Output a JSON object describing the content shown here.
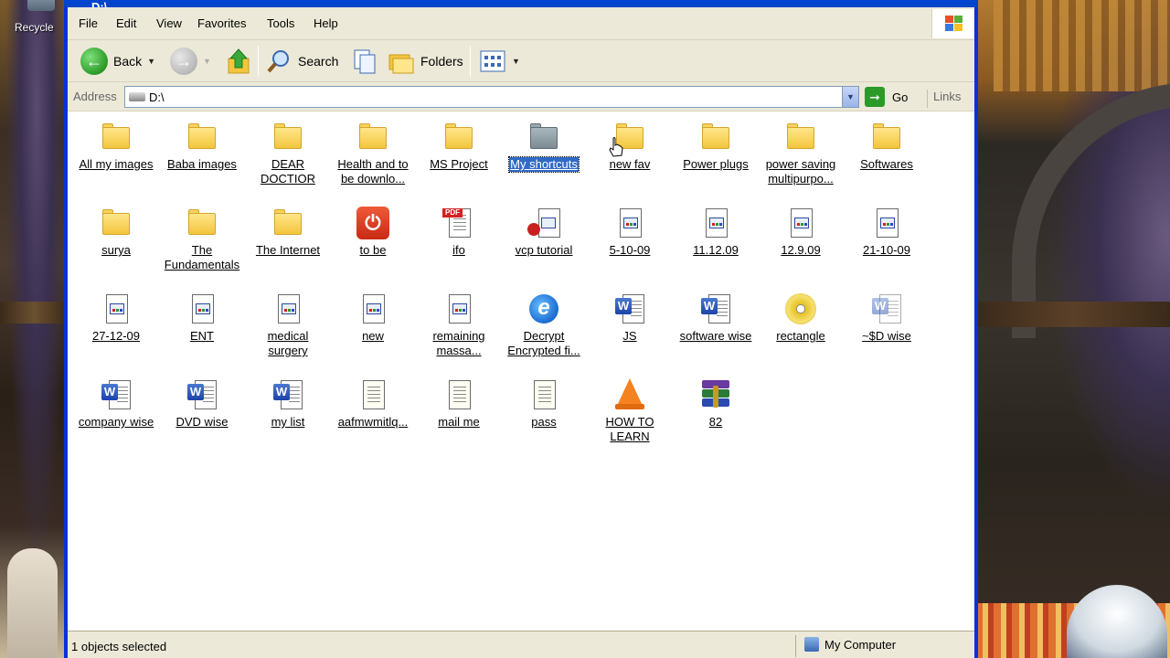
{
  "desktop": {
    "recycle_label": "Recycle"
  },
  "window": {
    "title": "D:\\"
  },
  "menu": [
    "File",
    "Edit",
    "View",
    "Favorites",
    "Tools",
    "Help"
  ],
  "toolbar": {
    "back": "Back",
    "search": "Search",
    "folders": "Folders"
  },
  "address": {
    "label": "Address",
    "value": "D:\\",
    "go": "Go",
    "links": "Links"
  },
  "items": [
    {
      "name": "All my images",
      "type": "folder"
    },
    {
      "name": "Baba images",
      "type": "folder"
    },
    {
      "name": "DEAR DOCTIOR",
      "type": "folder"
    },
    {
      "name": "Health and to be downlo...",
      "type": "folder"
    },
    {
      "name": "MS Project",
      "type": "folder"
    },
    {
      "name": "My shortcuts",
      "type": "folder-shortcut",
      "selected": true
    },
    {
      "name": "new fav",
      "type": "folder"
    },
    {
      "name": "Power plugs",
      "type": "folder"
    },
    {
      "name": "power saving multipurpo...",
      "type": "folder"
    },
    {
      "name": "Softwares",
      "type": "folder"
    },
    {
      "name": "surya",
      "type": "folder"
    },
    {
      "name": "The Fundamentals",
      "type": "folder"
    },
    {
      "name": "The Internet",
      "type": "folder"
    },
    {
      "name": "to be",
      "type": "power-app"
    },
    {
      "name": "ifo",
      "type": "pdf"
    },
    {
      "name": "vcp tutorial",
      "type": "vcp"
    },
    {
      "name": "5-10-09",
      "type": "doc"
    },
    {
      "name": "11.12.09",
      "type": "doc"
    },
    {
      "name": "12.9.09",
      "type": "doc"
    },
    {
      "name": "21-10-09",
      "type": "doc"
    },
    {
      "name": "27-12-09",
      "type": "doc"
    },
    {
      "name": "ENT",
      "type": "doc"
    },
    {
      "name": "medical surgery",
      "type": "doc"
    },
    {
      "name": "new",
      "type": "doc"
    },
    {
      "name": "remaining massa...",
      "type": "doc"
    },
    {
      "name": "Decrypt Encrypted fi...",
      "type": "ie"
    },
    {
      "name": "JS",
      "type": "word"
    },
    {
      "name": "software wise",
      "type": "word"
    },
    {
      "name": "rectangle",
      "type": "cd"
    },
    {
      "name": "~$D wise",
      "type": "word-ghost"
    },
    {
      "name": "company wise",
      "type": "word"
    },
    {
      "name": "DVD wise",
      "type": "word"
    },
    {
      "name": "my list",
      "type": "word"
    },
    {
      "name": "aafmwmitlq...",
      "type": "text"
    },
    {
      "name": "mail me",
      "type": "text"
    },
    {
      "name": "pass",
      "type": "text"
    },
    {
      "name": "HOW TO LEARN",
      "type": "vlc"
    },
    {
      "name": "82",
      "type": "rar"
    }
  ],
  "status": {
    "selected_text": "1 objects selected",
    "location": "My Computer"
  }
}
